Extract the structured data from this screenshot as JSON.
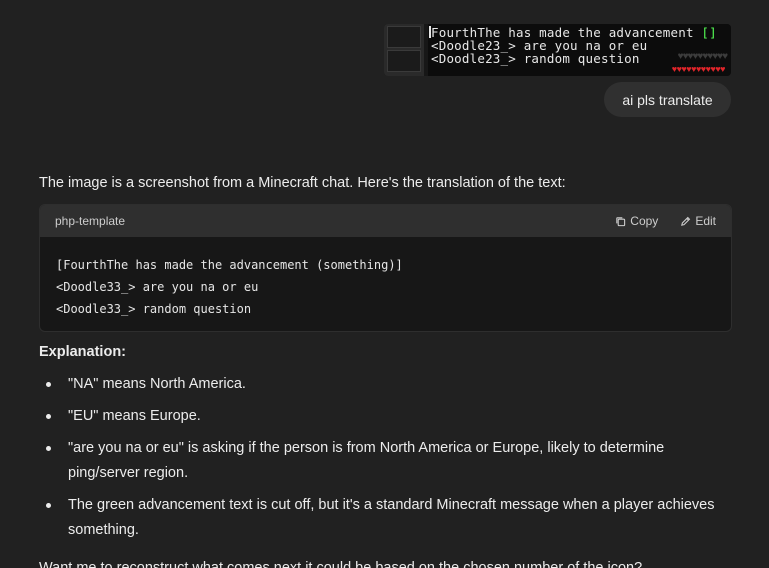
{
  "user": {
    "image": {
      "chat_lines": [
        {
          "text": "FourthThe has made the advancement ",
          "extra": "[]"
        },
        {
          "text": "<Doodle23_> are you na or eu",
          "extra": ""
        },
        {
          "text": "<Doodle23_> random question",
          "extra": ""
        }
      ]
    },
    "message": "ai pls translate"
  },
  "assistant": {
    "intro": "The image is a screenshot from a Minecraft chat. Here's the translation of the text:",
    "code": {
      "language": "php-template",
      "copy_label": "Copy",
      "edit_label": "Edit",
      "lines": [
        "[FourthThe has made the advancement (something)]",
        "<Doodle33_> are you na or eu",
        "<Doodle33_> random question"
      ]
    },
    "explanation_title": "Explanation:",
    "bullets": [
      "\"NA\" means North America.",
      "\"EU\" means Europe.",
      "\"are you na or eu\" is asking if the person is from North America or Europe, likely to determine ping/server region.",
      "The green advancement text is cut off, but it's a standard Minecraft message when a player achieves something."
    ],
    "cutoff_text": "Want me to reconstruct what comes next it could be based on the chosen number of the icon?"
  }
}
